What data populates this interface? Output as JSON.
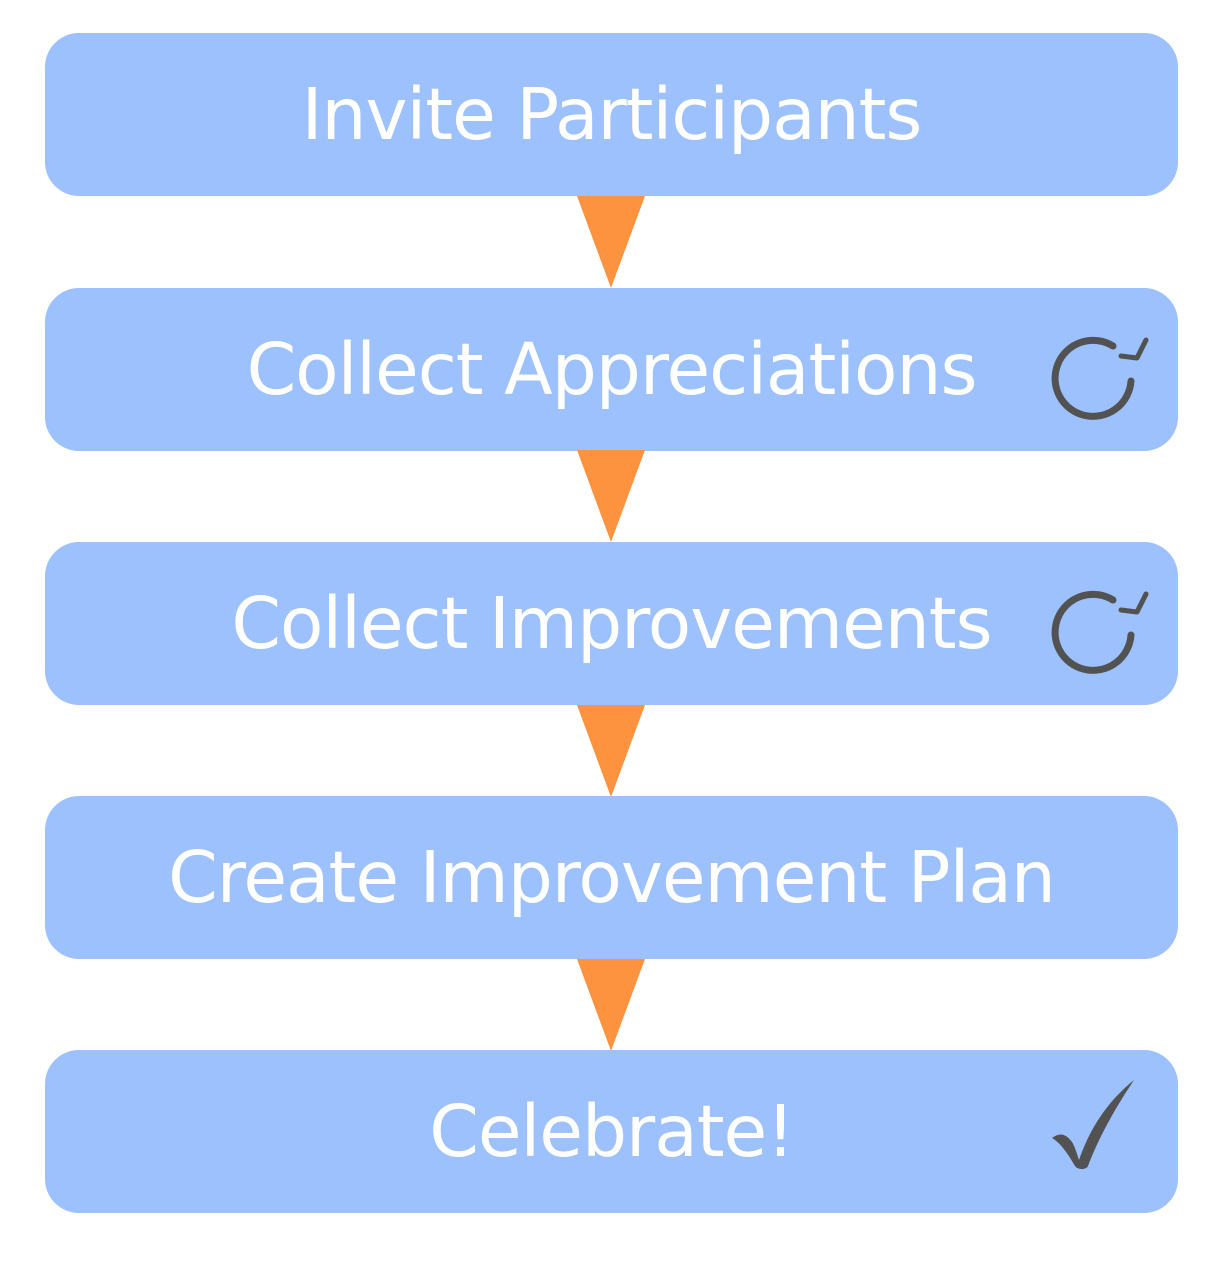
{
  "steps": [
    {
      "label": "Invite Participants",
      "icon": "none"
    },
    {
      "label": "Collect Appreciations",
      "icon": "repeat-icon"
    },
    {
      "label": "Collect Improvements",
      "icon": "repeat-icon"
    },
    {
      "label": "Create Improvement Plan",
      "icon": "none"
    },
    {
      "label": "Celebrate!",
      "icon": "check-icon"
    }
  ],
  "colors": {
    "step_fill": "#9dc1fc",
    "step_text": "#ffffff",
    "connector": "#fd923f",
    "icon": "#525252"
  }
}
